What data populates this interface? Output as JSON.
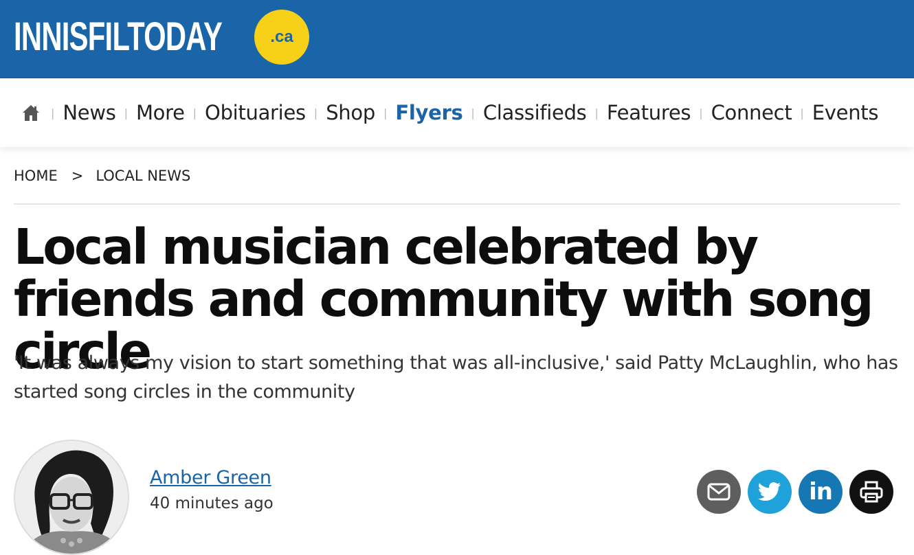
{
  "site": {
    "logo_text": "INNISFILTODAY",
    "logo_badge": ".ca",
    "brand_color": "#1a64a8",
    "badge_color": "#f7d117"
  },
  "nav": {
    "home_icon": "home-icon",
    "items": [
      {
        "label": "News"
      },
      {
        "label": "More"
      },
      {
        "label": "Obituaries"
      },
      {
        "label": "Shop"
      },
      {
        "label": "Flyers",
        "active": true
      },
      {
        "label": "Classifieds"
      },
      {
        "label": "Features"
      },
      {
        "label": "Connect"
      },
      {
        "label": "Events"
      }
    ],
    "separator": "|"
  },
  "breadcrumb": {
    "home": "HOME",
    "separator": ">",
    "section": "LOCAL NEWS"
  },
  "article": {
    "headline": "Local musician celebrated by friends and community with song circle",
    "subtitle": "'It was always my vision to start something that was all-inclusive,' said Patty McLaughlin, who has started song circles in the community",
    "author": {
      "name": "Amber Green",
      "time": "40 minutes ago"
    }
  },
  "share": {
    "email_icon": "email-icon",
    "twitter_icon": "twitter-icon",
    "linkedin_text": "in",
    "print_icon": "print-icon",
    "colors": {
      "email": "#5e5e5e",
      "twitter": "#1fa1d9",
      "linkedin": "#1578b5",
      "print": "#111111"
    }
  }
}
